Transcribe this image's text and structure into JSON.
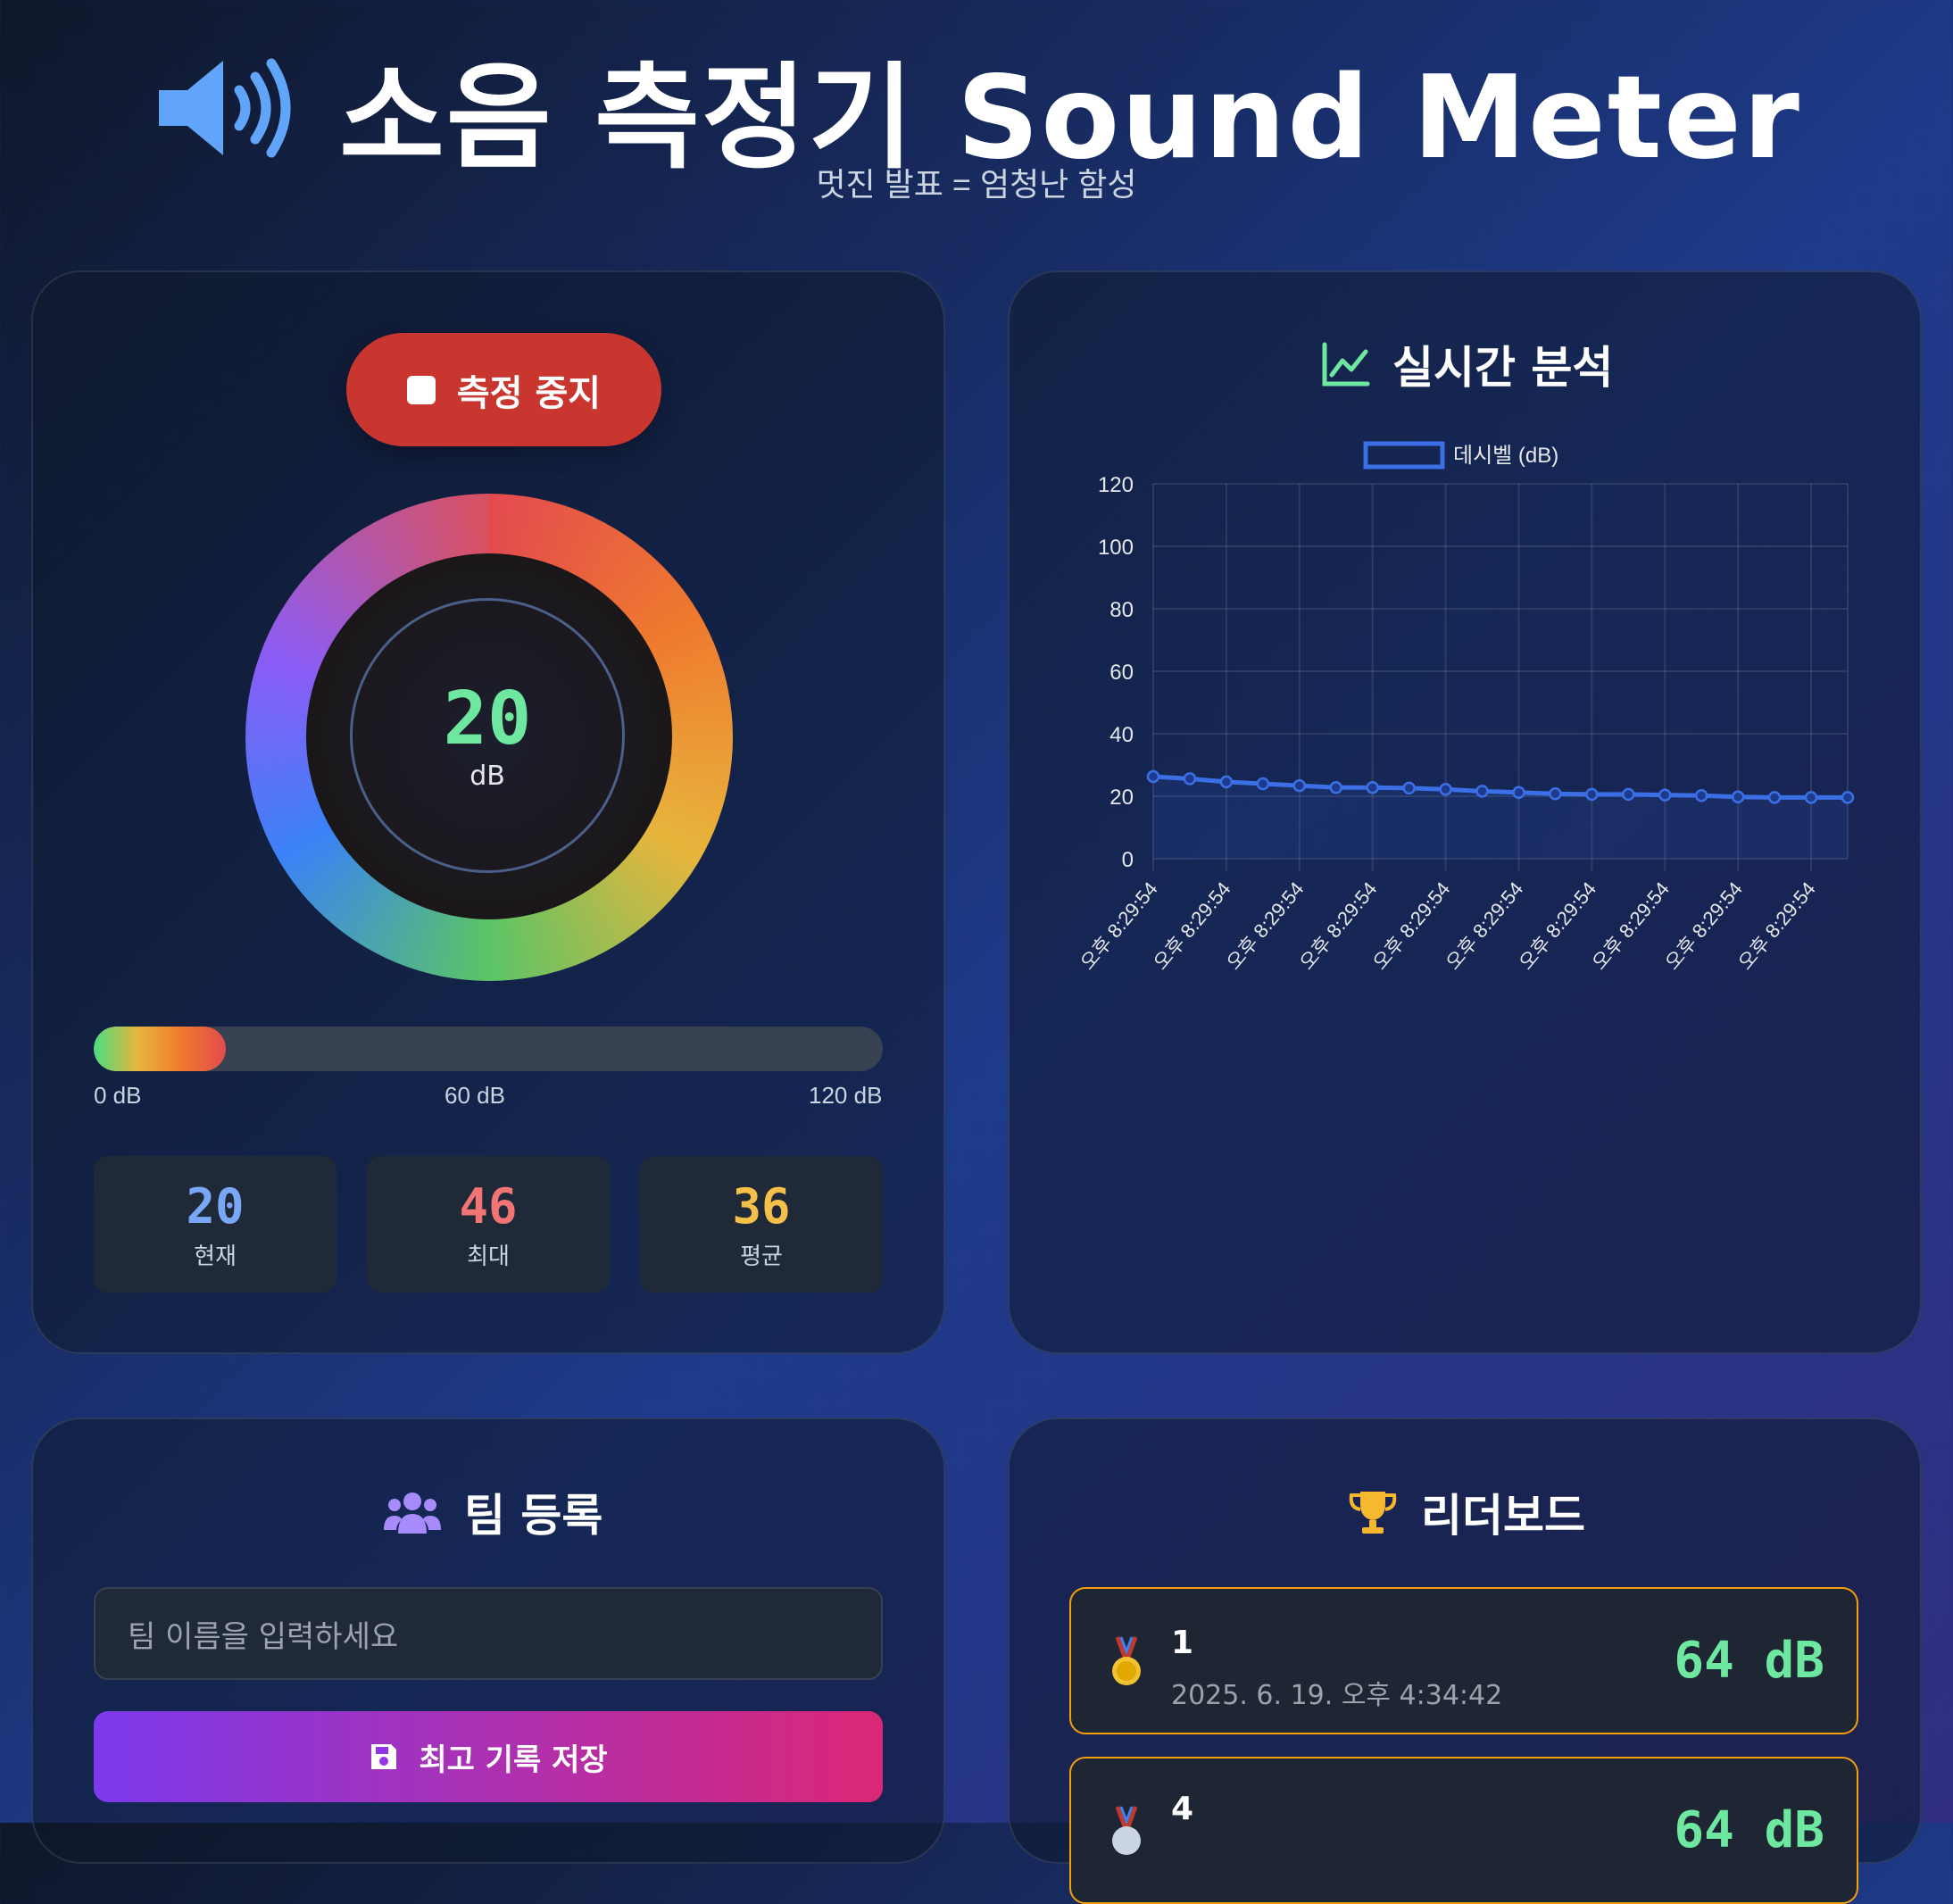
{
  "header": {
    "title": "소음 측정기 Sound Meter",
    "subtitle": "멋진 발표 = 엄청난 함성",
    "icon": "speaker-volume-icon"
  },
  "meter": {
    "stop_label": "측정 중지",
    "value": "20",
    "unit": "dB",
    "level_fraction": 0.167,
    "scale": {
      "min": "0 dB",
      "mid": "60 dB",
      "max": "120 dB"
    },
    "stats": [
      {
        "value": "20",
        "label": "현재",
        "color": "#7aa7f5"
      },
      {
        "value": "46",
        "label": "최대",
        "color": "#f27474"
      },
      {
        "value": "36",
        "label": "평균",
        "color": "#f5c04a"
      }
    ]
  },
  "analysis": {
    "title": "실시간 분석",
    "icon": "chart-line-icon"
  },
  "chart_data": {
    "type": "line",
    "title": "",
    "legend": "top",
    "series": [
      {
        "name": "데시벨 (dB)",
        "color": "#3b6fe6",
        "values": [
          26.3,
          25.6,
          24.6,
          24.0,
          23.4,
          22.8,
          22.8,
          22.6,
          22.2,
          21.6,
          21.2,
          20.8,
          20.6,
          20.6,
          20.4,
          20.2,
          19.8,
          19.6,
          19.6,
          19.6
        ]
      }
    ],
    "x_ticks": [
      "오후 8:29:54",
      "오후 8:29:54",
      "오후 8:29:54",
      "오후 8:29:54",
      "오후 8:29:54",
      "오후 8:29:54",
      "오후 8:29:54",
      "오후 8:29:54",
      "오후 8:29:54",
      "오후 8:29:54"
    ],
    "y_ticks": [
      "0",
      "20",
      "40",
      "60",
      "80",
      "100",
      "120"
    ],
    "ylim": [
      0,
      120
    ],
    "grid": true
  },
  "team": {
    "title": "팀 등록",
    "icon": "users-icon",
    "input_placeholder": "팀 이름을 입력하세요",
    "save_label": "최고 기록 저장",
    "save_icon": "floppy-disk-icon"
  },
  "leaderboard": {
    "title": "리더보드",
    "icon": "trophy-icon",
    "entries": [
      {
        "rank": "1",
        "date": "2025. 6. 19. 오후 4:34:42",
        "score": "64 dB",
        "icon": "gold-medal-icon"
      },
      {
        "rank": "4",
        "date": "",
        "score": "64 dB",
        "icon": "medal-icon"
      }
    ]
  }
}
